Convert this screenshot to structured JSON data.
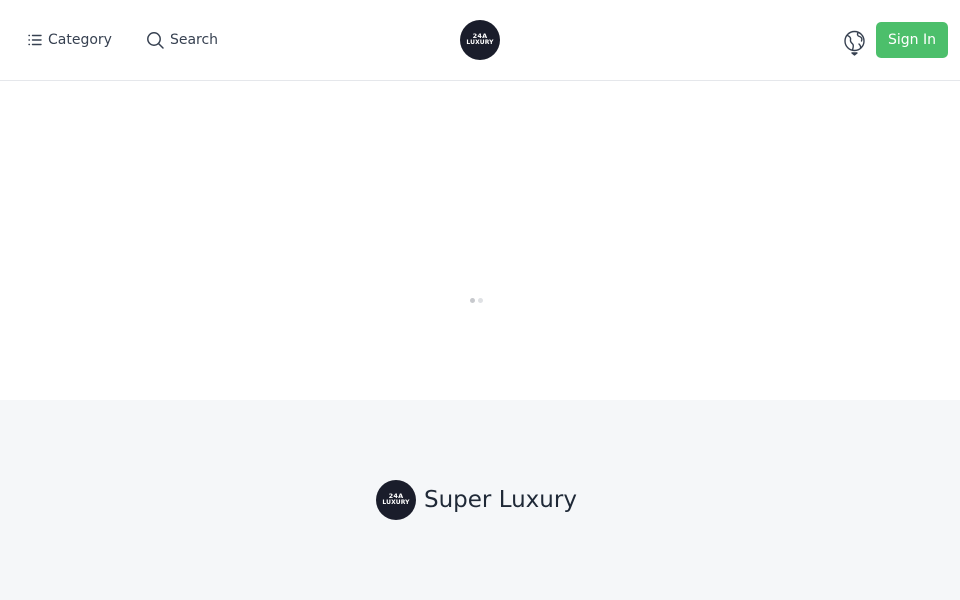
{
  "header": {
    "category_label": "Category",
    "search_label": "Search",
    "logo": {
      "line1": "24A",
      "line2": "LUXURY"
    },
    "language_icon": "globe-icon",
    "signin_label": "Sign In"
  },
  "footer": {
    "logo": {
      "line1": "24A",
      "line2": "LUXURY"
    },
    "brand_name": "Super Luxury"
  },
  "colors": {
    "accent": "#4cbf6b",
    "logo_bg": "#1a1d2b",
    "footer_bg": "#f5f7f9",
    "border": "#e5e7eb"
  }
}
